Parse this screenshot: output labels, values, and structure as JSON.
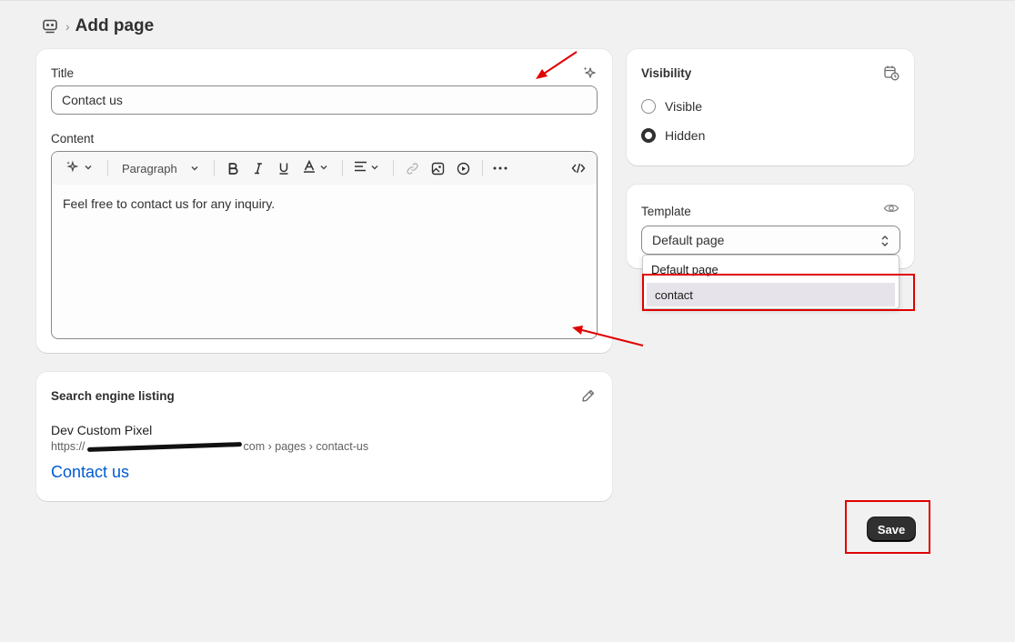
{
  "header": {
    "breadcrumb_icon": "pages-icon",
    "title": "Add page"
  },
  "title_card": {
    "title_label": "Title",
    "title_value": "Contact us",
    "content_label": "Content",
    "toolbar": {
      "ai_icon": "sparkle-icon",
      "paragraph_label": "Paragraph",
      "icons": [
        "bold-icon",
        "italic-icon",
        "underline-icon",
        "text-color-icon",
        "align-icon",
        "link-icon",
        "image-icon",
        "video-icon",
        "more-icon",
        "code-icon"
      ]
    },
    "content_value": "Feel free to contact us for any inquiry."
  },
  "seo": {
    "heading": "Search engine listing",
    "site_name": "Dev Custom Pixel",
    "url_prefix": "https://",
    "url_suffix": "com › pages › contact-us",
    "page_title": "Contact us"
  },
  "visibility": {
    "heading": "Visibility",
    "options": [
      {
        "label": "Visible",
        "selected": false
      },
      {
        "label": "Hidden",
        "selected": true
      }
    ]
  },
  "template": {
    "heading": "Template",
    "selected": "Default page",
    "options": [
      "Default page",
      "contact"
    ],
    "highlighted": "contact"
  },
  "actions": {
    "save_label": "Save"
  },
  "colors": {
    "accent": "#303030",
    "link": "#005bd3",
    "annotation": "#e00000"
  }
}
